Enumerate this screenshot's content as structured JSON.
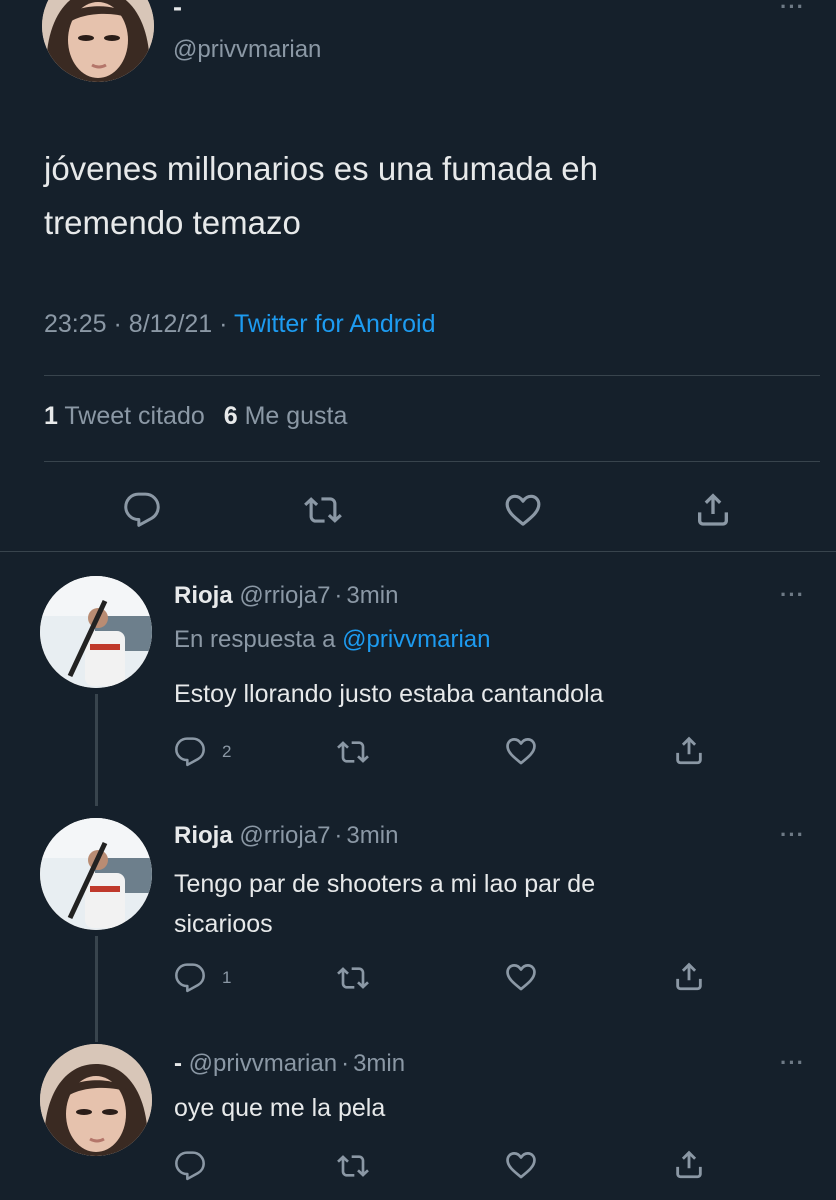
{
  "main_tweet": {
    "display_name": "-",
    "handle": "@privvmarian",
    "text_line1": "jóvenes millonarios es una fumada eh",
    "text_line2": "tremendo temazo",
    "time": "23:25",
    "date": "8/12/21",
    "source": "Twitter for Android",
    "quote_count": "1",
    "quote_label": "Tweet citado",
    "like_count": "6",
    "like_label": "Me gusta"
  },
  "replies": [
    {
      "display_name": "Rioja",
      "handle": "@rrioja7",
      "time": "3min",
      "reply_prefix": "En respuesta a",
      "reply_to": "@privvmarian",
      "text_line1": "Estoy llorando justo estaba cantandola",
      "reply_count": "2"
    },
    {
      "display_name": "Rioja",
      "handle": "@rrioja7",
      "time": "3min",
      "text_line1": "Tengo par de shooters a mi lao par de",
      "text_line2": "sicarioos",
      "reply_count": "1"
    },
    {
      "display_name": "-",
      "handle": "@privvmarian",
      "time": "3min",
      "text_line1": "oye que me la pela"
    }
  ],
  "separator_dot": "·",
  "more_glyph": "···",
  "icons": [
    "reply-icon",
    "retweet-icon",
    "like-icon",
    "share-icon",
    "more-icon"
  ],
  "colors": {
    "background": "#15202b",
    "text": "#e7e9ea",
    "muted": "#8b98a5",
    "link": "#1d9bf0",
    "divider": "#38444d"
  }
}
